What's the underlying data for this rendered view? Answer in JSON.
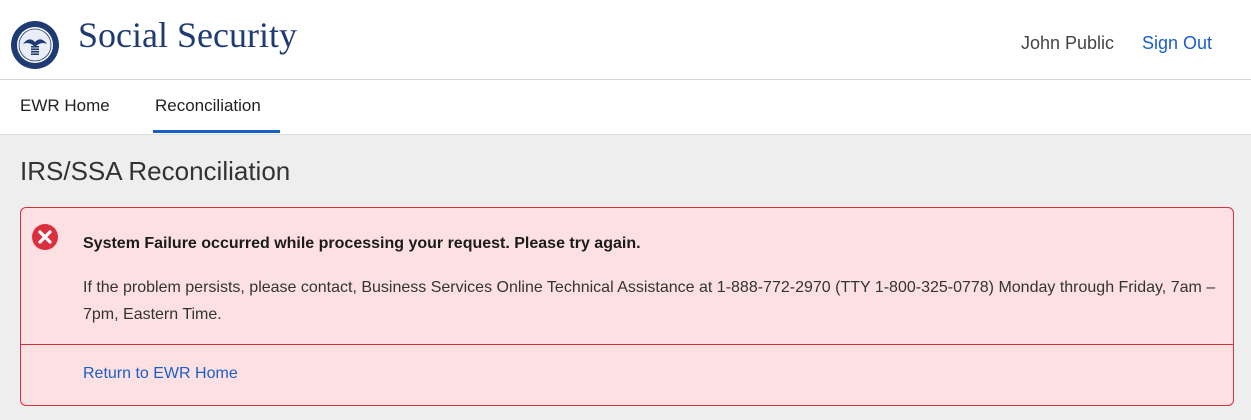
{
  "header": {
    "site_title": "Social Security",
    "user_name": "John Public",
    "sign_out_label": "Sign Out"
  },
  "nav": {
    "tabs": [
      {
        "label": "EWR Home",
        "active": false
      },
      {
        "label": "Reconciliation",
        "active": true
      }
    ]
  },
  "main": {
    "page_title": "IRS/SSA Reconciliation"
  },
  "alert": {
    "type": "error",
    "icon": "error-x-circle-icon",
    "heading": "System Failure occurred while processing your request. Please try again.",
    "body": "If the problem persists, please contact, Business Services Online Technical Assistance at 1-888-772-2970 (TTY 1-800-325-0778) Monday through Friday, 7am – 7pm, Eastern Time.",
    "link_label": "Return to EWR Home"
  },
  "colors": {
    "brand": "#1f3b73",
    "link": "#1a5ec8",
    "error": "#d9303d",
    "error_bg": "#fde0e2",
    "page_bg": "#eeeeee"
  }
}
